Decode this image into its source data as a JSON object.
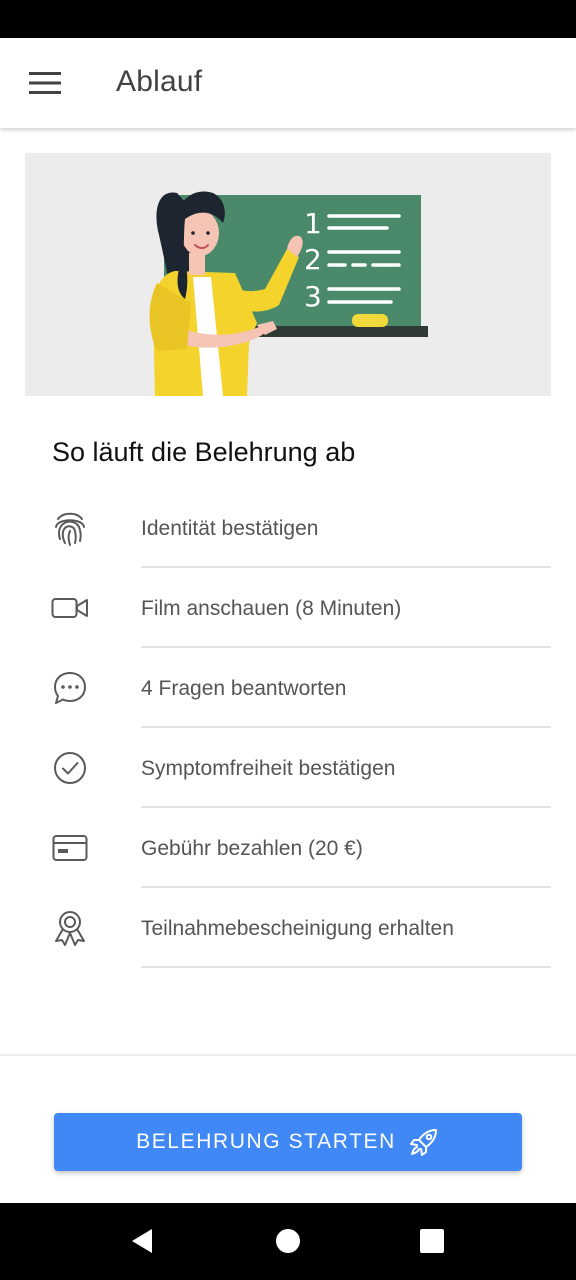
{
  "app_bar": {
    "title": "Ablauf",
    "menu_icon": "hamburger-menu-icon"
  },
  "hero": {
    "illustration": "teacher-at-chalkboard",
    "board_numbers": [
      "1",
      "2",
      "3"
    ]
  },
  "section_title": "So läuft die Belehrung ab",
  "steps": [
    {
      "icon": "fingerprint-icon",
      "label": "Identität bestätigen"
    },
    {
      "icon": "video-camera-icon",
      "label": "Film anschauen (8 Minuten)"
    },
    {
      "icon": "chat-bubble-icon",
      "label": "4 Fragen beantworten"
    },
    {
      "icon": "check-circle-icon",
      "label": "Symptomfreiheit bestätigen"
    },
    {
      "icon": "credit-card-icon",
      "label": "Gebühr bezahlen (20 €)"
    },
    {
      "icon": "award-ribbon-icon",
      "label": "Teilnahmebescheinigung erhalten"
    }
  ],
  "start_button": {
    "label": "BELEHRUNG STARTEN",
    "icon": "rocket-icon"
  },
  "colors": {
    "accent": "#3f88f5",
    "chalkboard": "#4a8a6a",
    "hero_background": "#ececec"
  },
  "nav_bar": {
    "back_icon": "back-triangle-icon",
    "home_icon": "home-circle-icon",
    "recents_icon": "recents-square-icon"
  }
}
